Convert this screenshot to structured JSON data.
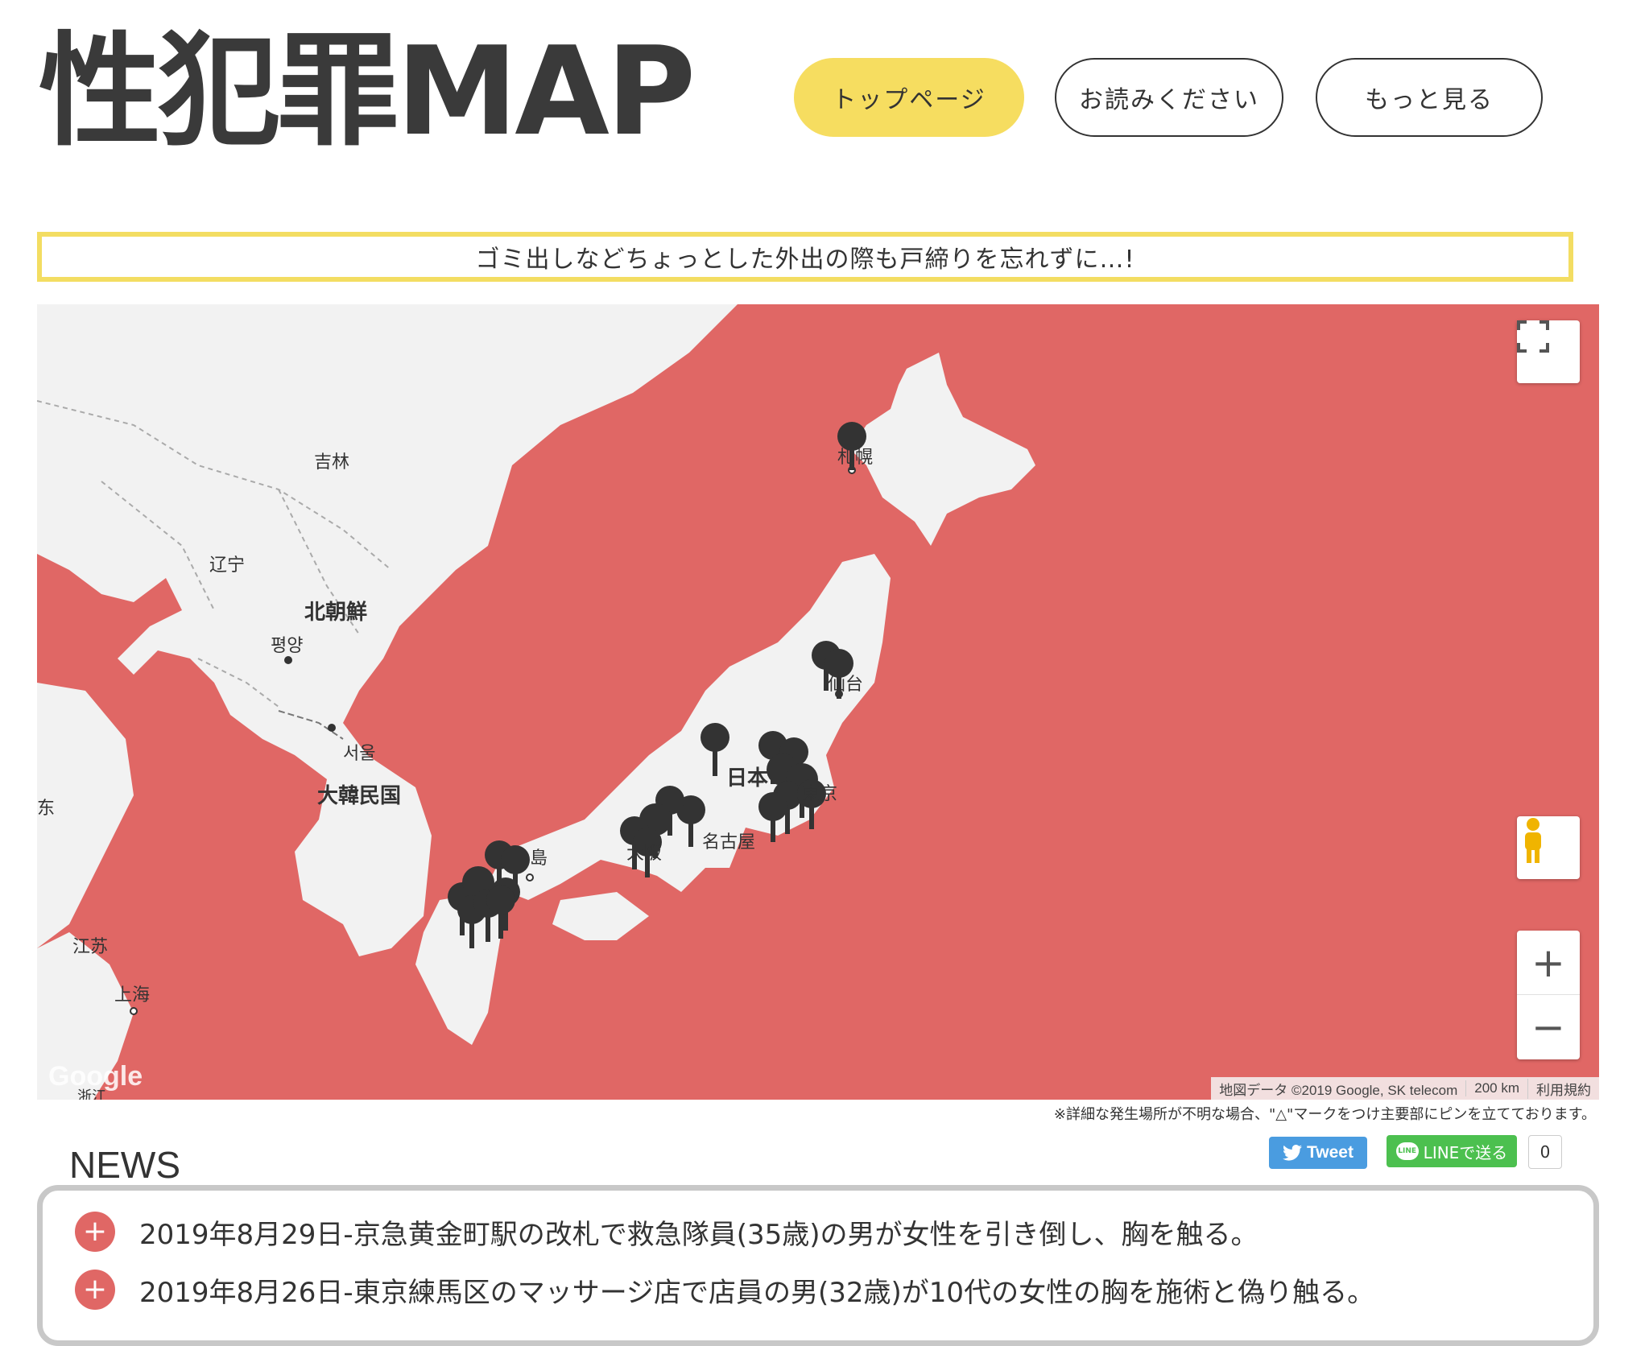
{
  "header": {
    "logo": "性犯罪MAP",
    "nav": [
      {
        "label": "トップページ",
        "active": true
      },
      {
        "label": "お読みください",
        "active": false
      },
      {
        "label": "もっと見る",
        "active": false
      }
    ]
  },
  "notice": "ゴミ出しなどちょっとした外出の際も戸締りを忘れずに…!",
  "map": {
    "labels": {
      "jilin": "吉林",
      "liaoning": "辽宁",
      "north_korea": "北朝鮮",
      "pyongyang": "평양",
      "seoul": "서울",
      "south_korea": "大韓民国",
      "east": "东",
      "jiangsu": "江苏",
      "shanghai": "上海",
      "zhejiang": "浙江",
      "sapporo": "札幌",
      "sendai": "仙台",
      "japan": "日本",
      "nagoya": "名古屋",
      "hiroshima": "島",
      "osaka": "大阪",
      "tokyo": "東京"
    },
    "google_logo": "Google",
    "attribution": [
      "地図データ ©2019 Google, SK telecom",
      "200 km",
      "利用規約"
    ],
    "controls": {
      "fullscreen": "fullscreen-icon",
      "pegman": "pegman-icon",
      "zoom_in": "+",
      "zoom_out": "−"
    },
    "colors": {
      "water": "#e06765",
      "land": "#f2f2f2",
      "pin": "#333333"
    }
  },
  "footnote": "※詳細な発生場所が不明な場合、\"△\"マークをつけ主要部にピンを立てております。",
  "news": {
    "title": "NEWS",
    "tweet_label": "Tweet",
    "line_label": "LINEで送る",
    "line_count": "0",
    "items": [
      "2019年8月29日-京急黄金町駅の改札で救急隊員(35歳)の男が女性を引き倒し、胸を触る。",
      "2019年8月26日-東京練馬区のマッサージ店で店員の男(32歳)が10代の女性の胸を施術と偽り触る。"
    ]
  }
}
